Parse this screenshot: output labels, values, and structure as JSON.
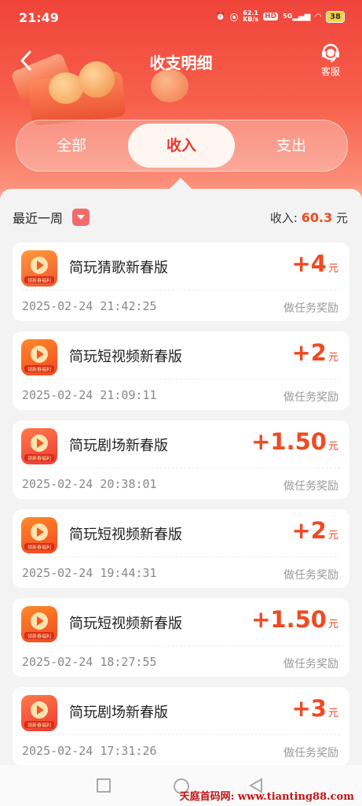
{
  "status_bar": {
    "time": "21:49",
    "speed_top": "62.1",
    "speed_bottom": "KB/s",
    "hd": "HD",
    "net": "5G",
    "battery": "38"
  },
  "header": {
    "title": "收支明细",
    "service_label": "客服"
  },
  "tabs": [
    {
      "label": "全部"
    },
    {
      "label": "收入"
    },
    {
      "label": "支出"
    }
  ],
  "filter": {
    "period": "最近一周"
  },
  "summary": {
    "label": "收入:",
    "value": "60.3",
    "unit": "元"
  },
  "records": [
    {
      "name": "简玩猜歌新春版",
      "amount": "+4",
      "unit": "元",
      "date": "2025-02-24  21:42:25",
      "reason": "做任务奖励",
      "icon": "music-app-icon"
    },
    {
      "name": "简玩短视频新春版",
      "amount": "+2",
      "unit": "元",
      "date": "2025-02-24  21:09:11",
      "reason": "做任务奖励",
      "icon": "video-app-icon"
    },
    {
      "name": "简玩剧场新春版",
      "amount": "+1.50",
      "unit": "元",
      "date": "2025-02-24  20:38:01",
      "reason": "做任务奖励",
      "icon": "theater-app-icon"
    },
    {
      "name": "简玩短视频新春版",
      "amount": "+2",
      "unit": "元",
      "date": "2025-02-24  19:44:31",
      "reason": "做任务奖励",
      "icon": "video-app-icon"
    },
    {
      "name": "简玩短视频新春版",
      "amount": "+1.50",
      "unit": "元",
      "date": "2025-02-24  18:27:55",
      "reason": "做任务奖励",
      "icon": "video-app-icon"
    },
    {
      "name": "简玩剧场新春版",
      "amount": "+3",
      "unit": "元",
      "date": "2025-02-24  17:31:26",
      "reason": "做任务奖励",
      "icon": "theater-app-icon"
    }
  ],
  "app_icon_caption": "领新春福利",
  "watermark": "天庭首码网: www.tianting88.com",
  "colors": {
    "accent": "#f0443a",
    "amount": "#f04a22",
    "tab_active_text": "#e5392e"
  }
}
